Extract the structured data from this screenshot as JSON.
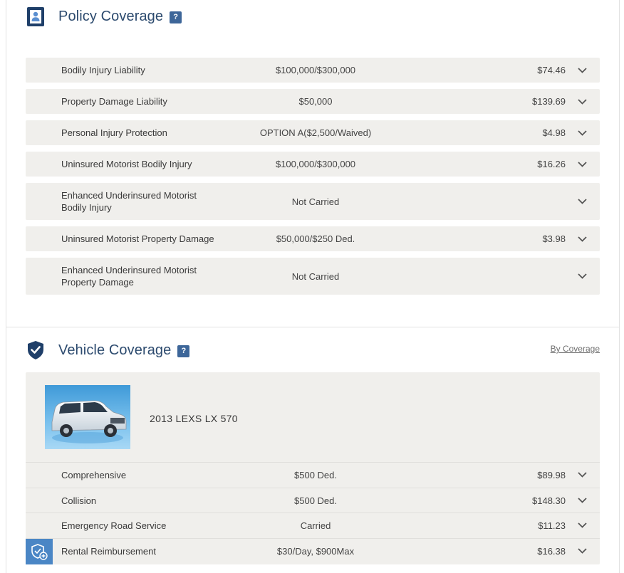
{
  "policy": {
    "title": "Policy Coverage",
    "help_label": "?",
    "rows": [
      {
        "name": "Bodily Injury Liability",
        "limit": "$100,000/$300,000",
        "premium": "$74.46"
      },
      {
        "name": "Property Damage Liability",
        "limit": "$50,000",
        "premium": "$139.69"
      },
      {
        "name": "Personal Injury Protection",
        "limit": "OPTION A($2,500/Waived)",
        "premium": "$4.98"
      },
      {
        "name": "Uninsured Motorist Bodily Injury",
        "limit": "$100,000/$300,000",
        "premium": "$16.26"
      },
      {
        "name_line1": "Enhanced Underinsured Motorist",
        "name_line2": "Bodily Injury",
        "limit": "Not Carried",
        "premium": ""
      },
      {
        "name": "Uninsured Motorist Property Damage",
        "limit": "$50,000/$250 Ded.",
        "premium": "$3.98"
      },
      {
        "name_line1": "Enhanced Underinsured Motorist",
        "name_line2": "Property Damage",
        "limit": "Not Carried",
        "premium": ""
      }
    ]
  },
  "vehicle": {
    "title": "Vehicle Coverage",
    "help_label": "?",
    "by_coverage_link": "By Coverage",
    "vehicle_name": "2013 LEXS LX 570",
    "rows": [
      {
        "name": "Comprehensive",
        "limit": "$500 Ded.",
        "premium": "$89.98"
      },
      {
        "name": "Collision",
        "limit": "$500 Ded.",
        "premium": "$148.30"
      },
      {
        "name": "Emergency Road Service",
        "limit": "Carried",
        "premium": "$11.23"
      },
      {
        "name": "Rental Reimbursement",
        "limit": "$30/Day, $900Max",
        "premium": "$16.38"
      }
    ]
  },
  "colors": {
    "title": "#2c4a6e",
    "help_badge": "#3d6699",
    "row_bg": "#f0efec",
    "icon_blue": "#2c4a6e",
    "rental_icon_bg": "#4a86c5"
  },
  "icons": {
    "policy": "person-document-icon",
    "vehicle": "shield-check-icon",
    "chevron": "chevron-down-icon",
    "rental": "shield-plus-icon"
  }
}
